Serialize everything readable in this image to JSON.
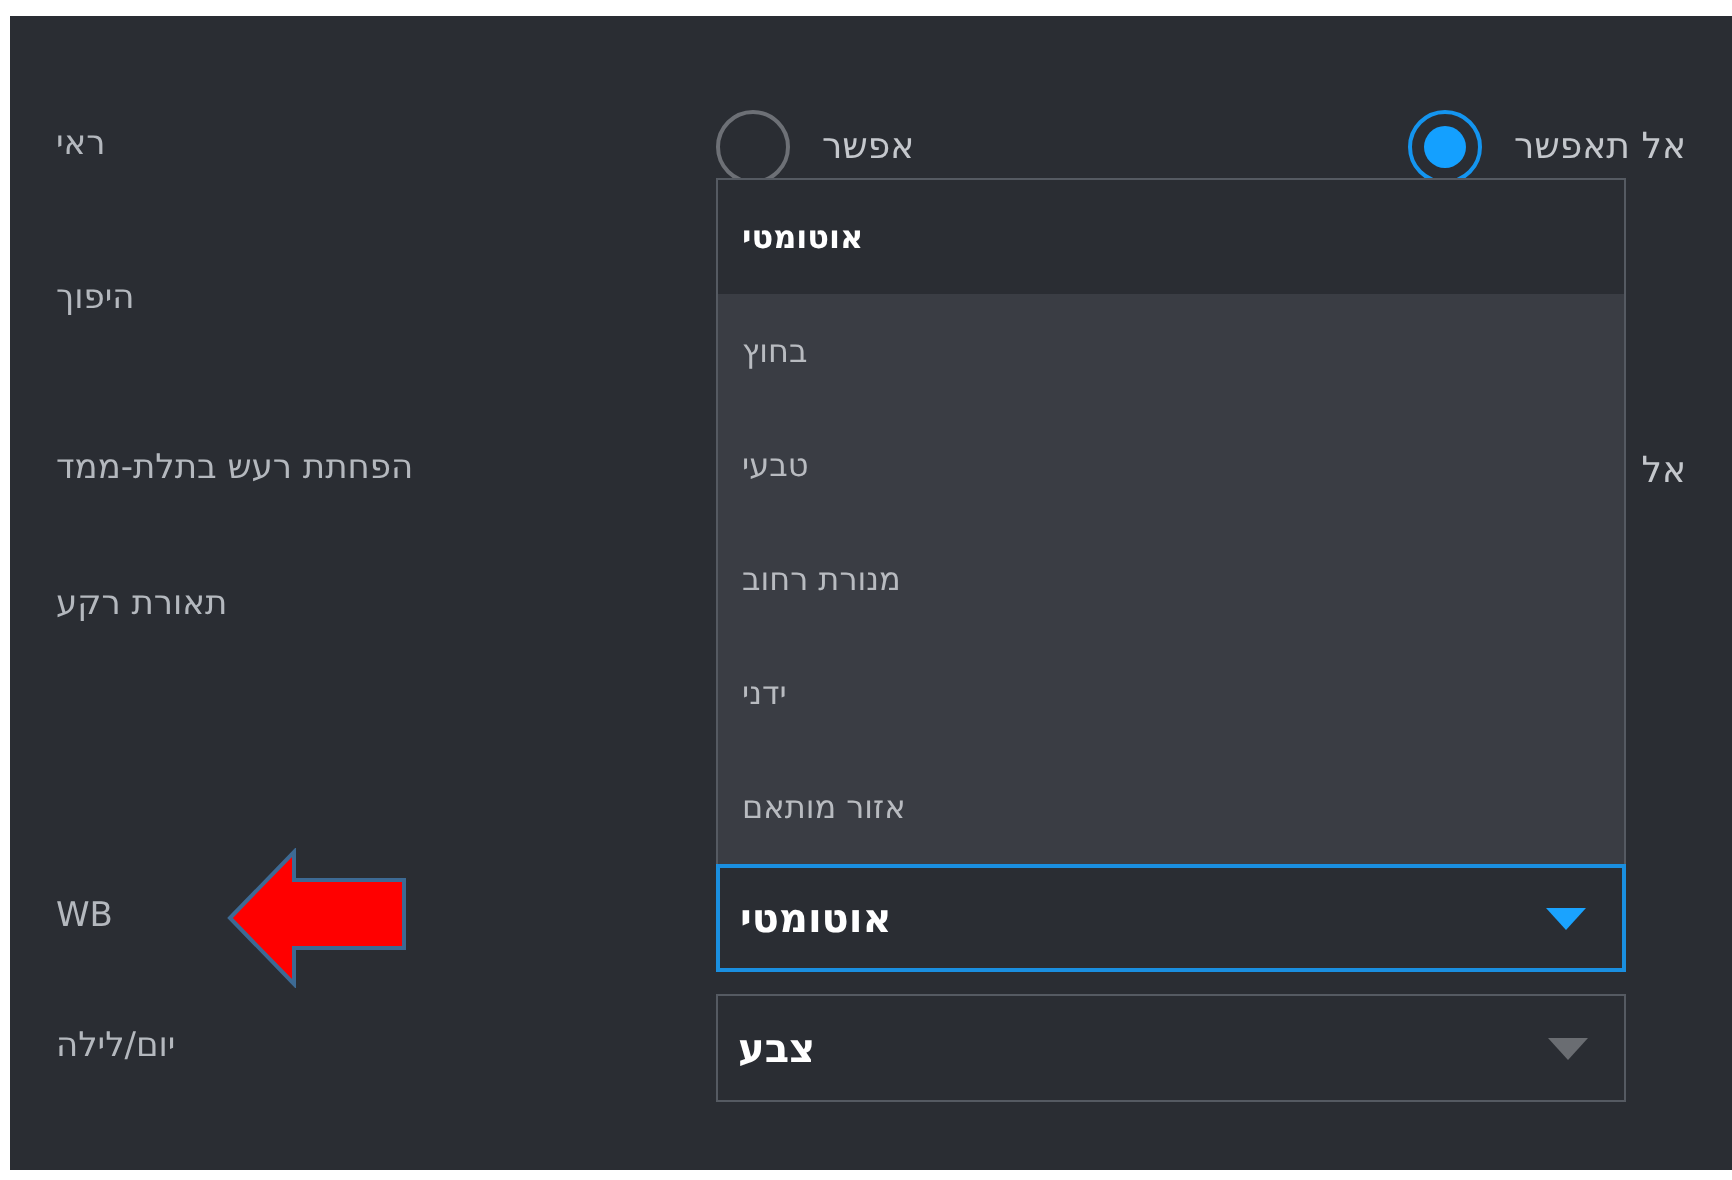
{
  "fields": [
    {
      "kind": "radio",
      "label": "ראי",
      "options": [
        {
          "label": "אל תאפשר",
          "selected": true
        },
        {
          "label": "אפשר",
          "selected": false
        }
      ]
    },
    {
      "kind": "label",
      "label": "היפוך"
    },
    {
      "kind": "partial",
      "label": "הפחתת רעש בתלת-ממד",
      "visible_text": "אל"
    },
    {
      "kind": "label",
      "label": "תאורת רקע"
    },
    {
      "kind": "select",
      "label": "WB",
      "value": "אוטומטי",
      "open": true,
      "marked": true,
      "options": [
        {
          "label": "אוטומטי",
          "selected": true
        },
        {
          "label": "בחוץ",
          "selected": false
        },
        {
          "label": "טבעי",
          "selected": false
        },
        {
          "label": "מנורת רחוב",
          "selected": false
        },
        {
          "label": "ידני",
          "selected": false
        },
        {
          "label": "אזור מותאם",
          "selected": false
        }
      ]
    },
    {
      "kind": "select",
      "label": "יום/לילה",
      "value": "צבע",
      "open": false,
      "marked": false
    }
  ]
}
